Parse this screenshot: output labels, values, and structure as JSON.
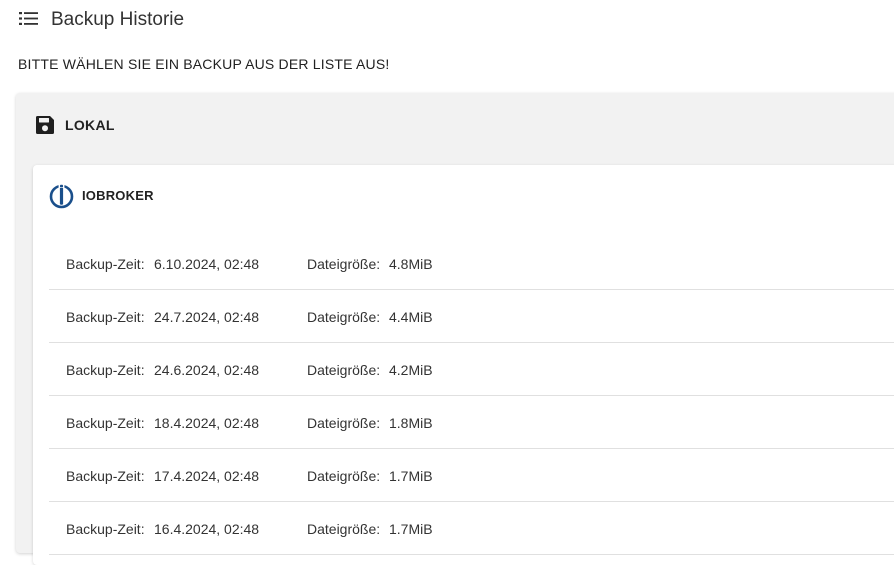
{
  "header": {
    "title": "Backup Historie",
    "icon": "list-icon"
  },
  "instruction": "BITTE WÄHLEN SIE EIN BACKUP AUS DER LISTE AUS!",
  "section": {
    "title": "LOKAL",
    "icon": "floppy-disk-icon",
    "group": {
      "title": "IOBROKER",
      "icon": "iobroker-logo",
      "logo_color": "#1a4f8b",
      "time_label": "Backup-Zeit:",
      "size_label": "Dateigröße:",
      "backups": [
        {
          "time": "6.10.2024, 02:48",
          "size": "4.8MiB"
        },
        {
          "time": "24.7.2024, 02:48",
          "size": "4.4MiB"
        },
        {
          "time": "24.6.2024, 02:48",
          "size": "4.2MiB"
        },
        {
          "time": "18.4.2024, 02:48",
          "size": "1.8MiB"
        },
        {
          "time": "17.4.2024, 02:48",
          "size": "1.7MiB"
        },
        {
          "time": "16.4.2024, 02:48",
          "size": "1.7MiB"
        }
      ]
    }
  }
}
